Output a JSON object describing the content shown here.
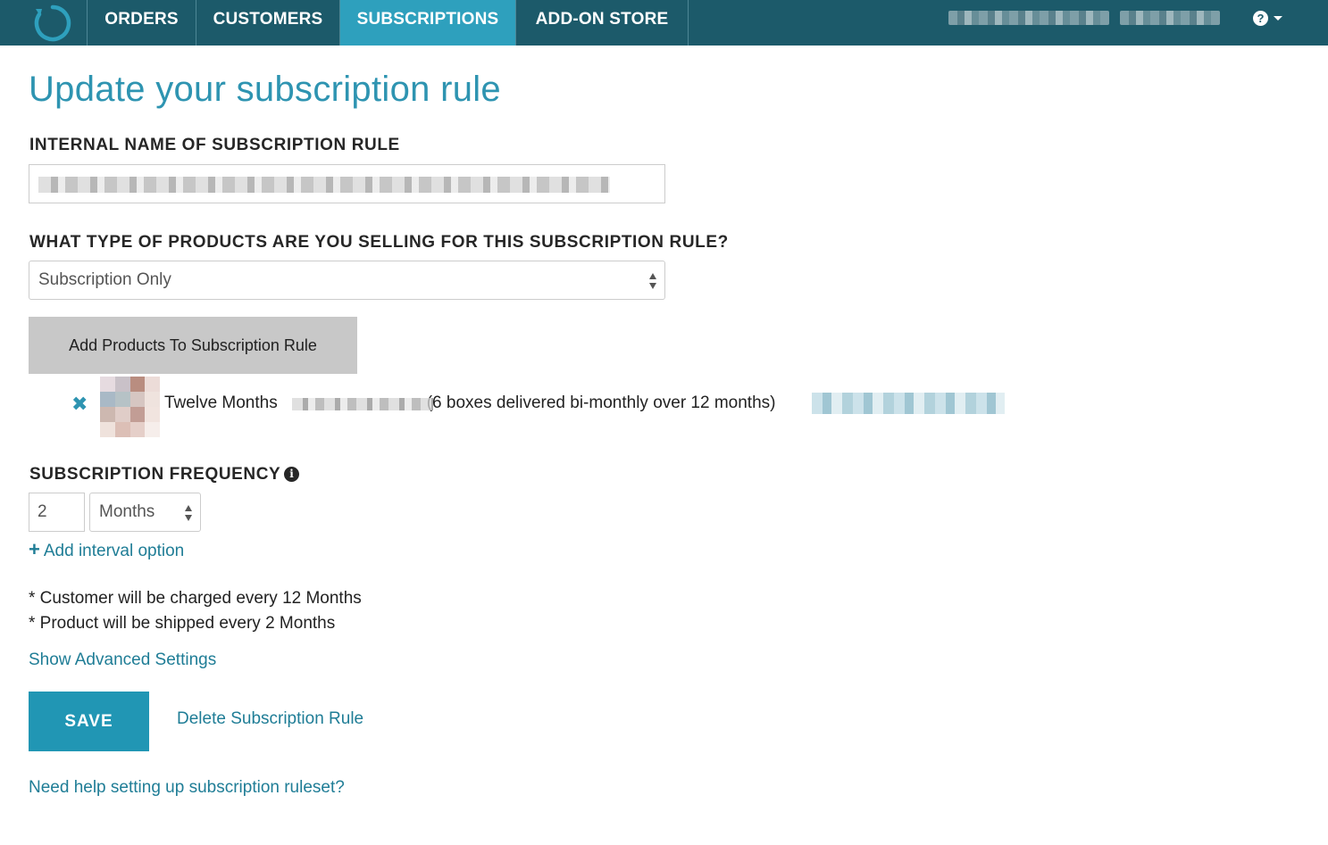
{
  "nav": {
    "tabs": [
      {
        "label": "ORDERS"
      },
      {
        "label": "CUSTOMERS"
      },
      {
        "label": "SUBSCRIPTIONS",
        "active": true
      },
      {
        "label": "ADD-ON STORE"
      }
    ],
    "help_icon": "question-circle-icon",
    "help_symbol": "?",
    "colors": {
      "bar": "#1c5a6a",
      "active": "#2ea0bd"
    }
  },
  "page": {
    "title": "Update your subscription rule",
    "name_label": "INTERNAL NAME OF SUBSCRIPTION RULE",
    "type_label": "WHAT TYPE OF PRODUCTS ARE YOU SELLING FOR THIS SUBSCRIPTION RULE?",
    "type_value": "Subscription Only",
    "add_products_label": "Add Products To Subscription Rule",
    "product": {
      "remove_symbol": "✖",
      "name_start": "Twelve Months",
      "name_end": "(6 boxes delivered bi-monthly over 12 months)"
    },
    "frequency_label": "SUBSCRIPTION FREQUENCY",
    "info_symbol": "i",
    "frequency_value": "2",
    "frequency_unit": "Months",
    "add_interval_plus": "+",
    "add_interval_label": "Add interval option",
    "note_charged": "* Customer will be charged every 12 Months",
    "note_shipped": "* Product will be shipped every 2 Months",
    "advanced_label": "Show Advanced Settings",
    "save_label": "SAVE",
    "delete_label": "Delete Subscription Rule",
    "help_link": "Need help setting up subscription ruleset?"
  }
}
